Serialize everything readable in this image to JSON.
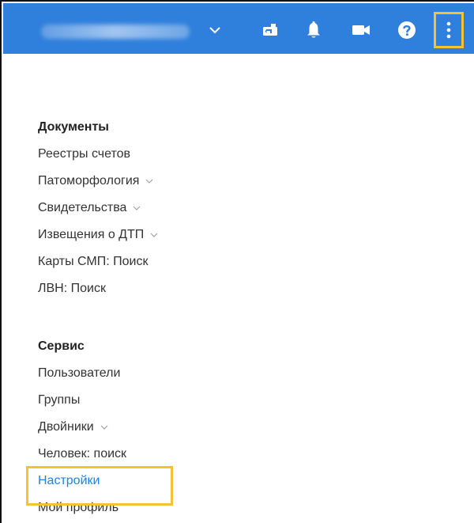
{
  "header": {
    "org_name": "",
    "accent_color": "#2f7fdc",
    "highlight_color": "#f5c233",
    "icons": [
      "chevron-down-icon",
      "handover-icon",
      "bell-icon",
      "video-camera-icon",
      "help-icon",
      "more-vertical-icon"
    ]
  },
  "menu": {
    "documents": {
      "title": "Документы",
      "items": [
        {
          "label": "Реестры счетов",
          "has_submenu": false
        },
        {
          "label": "Патоморфология",
          "has_submenu": true
        },
        {
          "label": "Свидетельства",
          "has_submenu": true
        },
        {
          "label": "Извещения о ДТП",
          "has_submenu": true
        },
        {
          "label": "Карты СМП: Поиск",
          "has_submenu": false
        },
        {
          "label": "ЛВН: Поиск",
          "has_submenu": false
        }
      ]
    },
    "service": {
      "title": "Сервис",
      "items": [
        {
          "label": "Пользователи",
          "has_submenu": false
        },
        {
          "label": "Группы",
          "has_submenu": false
        },
        {
          "label": "Двойники",
          "has_submenu": true
        },
        {
          "label": "Человек: поиск",
          "has_submenu": false
        },
        {
          "label": "Настройки",
          "has_submenu": false,
          "active": true
        },
        {
          "label": "Мой профиль",
          "has_submenu": false
        }
      ]
    },
    "active_color": "#1b84e7"
  }
}
